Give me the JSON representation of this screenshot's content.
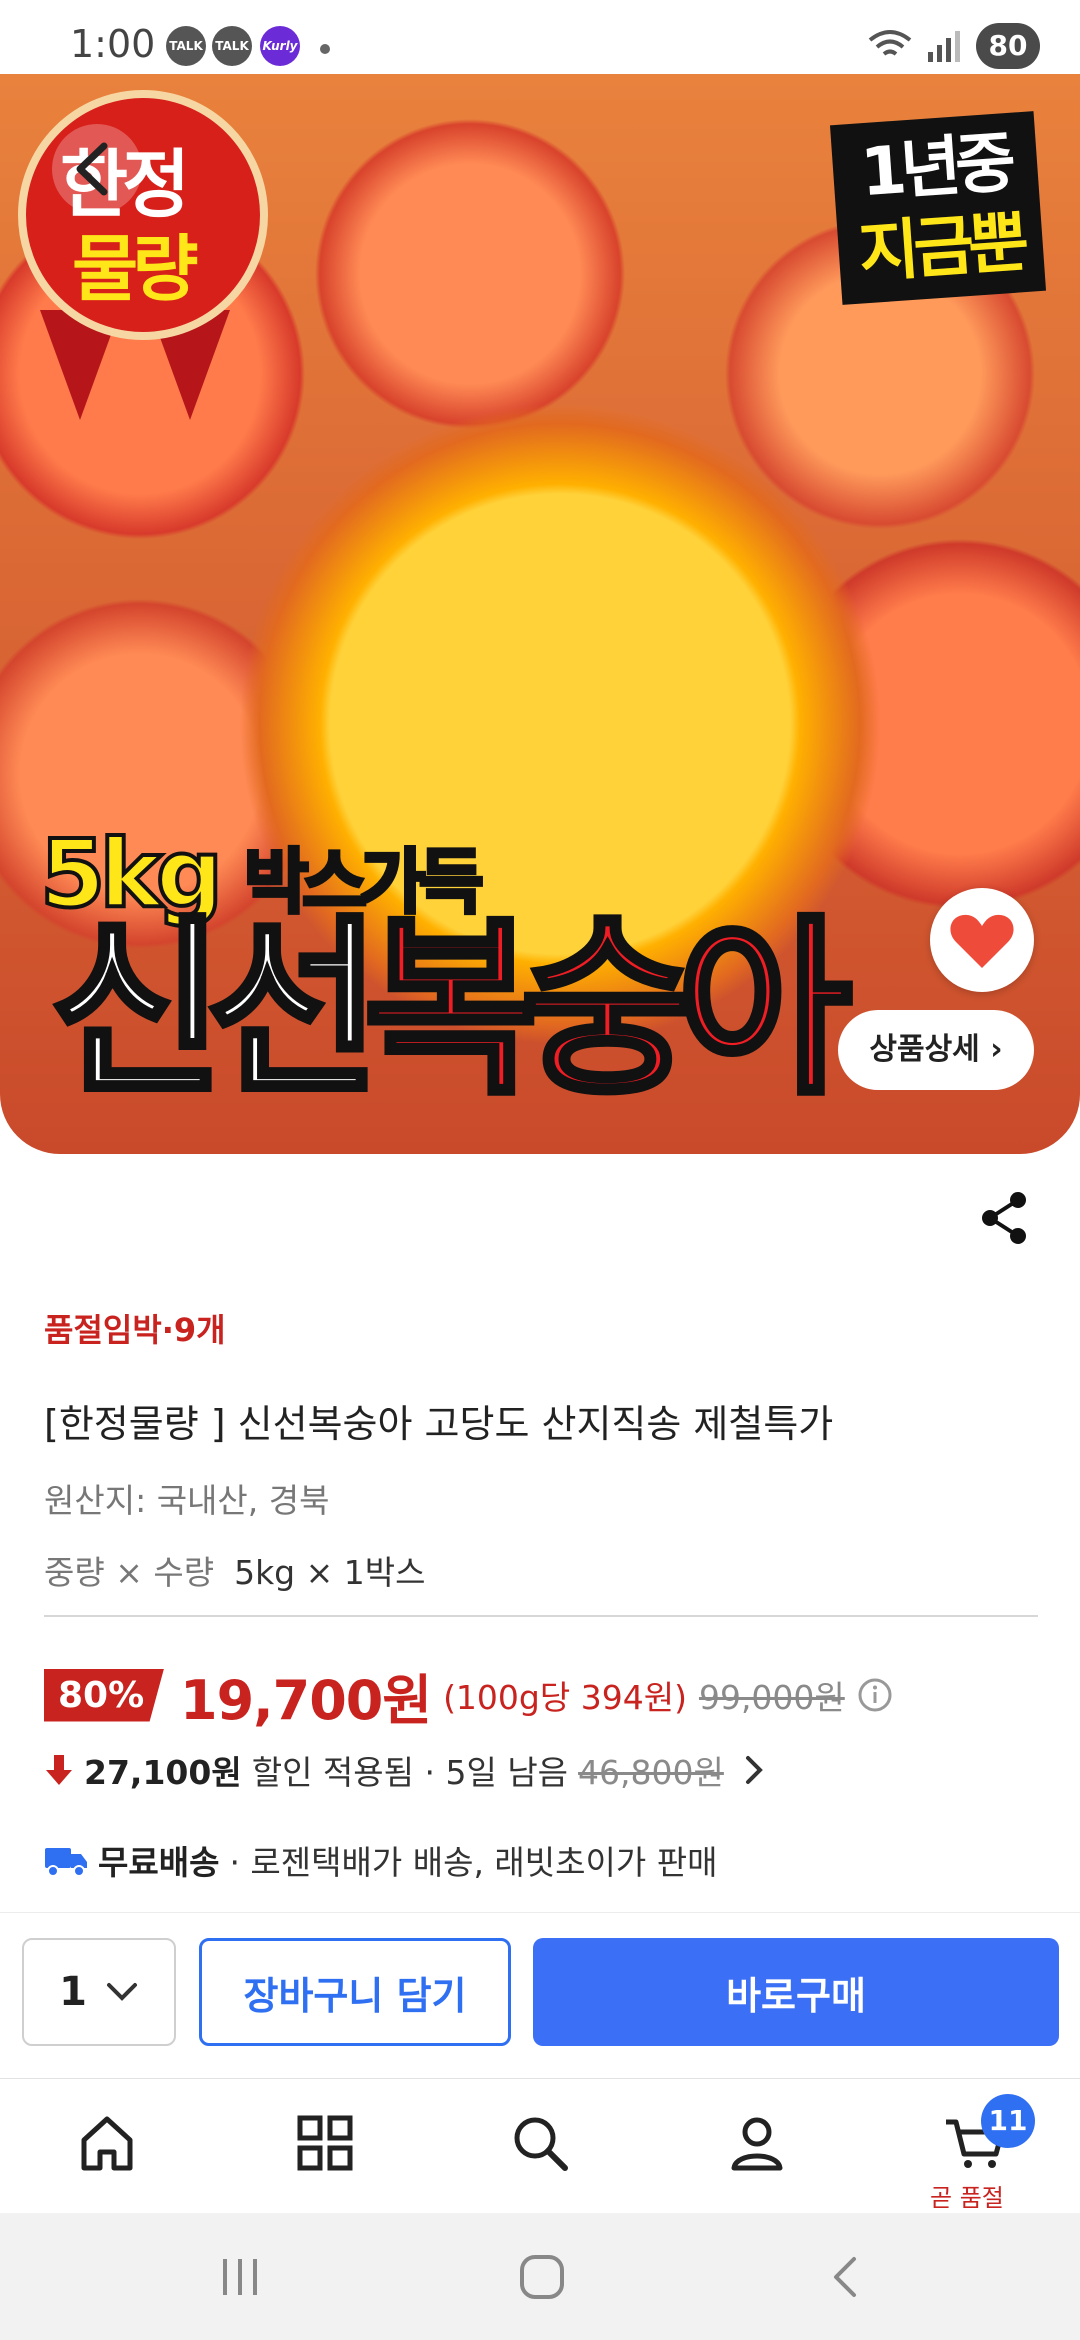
{
  "status_bar": {
    "time": "1:00",
    "talk1": "TALK",
    "talk2": "TALK",
    "kurly": "Kurly",
    "battery": "80"
  },
  "hero": {
    "seal_line1": "한정",
    "seal_line2": "물량",
    "badge_line1": "1년중",
    "badge_line2": "지금뿐",
    "line1_accent": "5kg",
    "line1_rest": "박스가득",
    "line2_white": "신선",
    "line2_red": "복숭아",
    "detail_button": "상품상세"
  },
  "product": {
    "stock_label": "품절임박·9개",
    "title": "[한정물량 ] 신선복숭아 고당도 산지직송 제철특가",
    "origin": "원산지: 국내산, 경북",
    "weight_label": "중량 × 수량",
    "weight_value": "5kg × 1박스"
  },
  "price": {
    "discount": "80%",
    "sale_price": "19,700원",
    "unit_price": "(100g당 394원)",
    "original_price": "99,000원"
  },
  "coupon": {
    "amount": "27,100원",
    "text": "할인 적용됨 · 5일 남음",
    "original": "46,800원"
  },
  "shipping": {
    "bold": "무료배송",
    "text": "· 로젠택배가 배송, 래빗초이가 판매"
  },
  "purchase": {
    "quantity": "1",
    "cart_label": "장바구니 담기",
    "buy_label": "바로구매"
  },
  "bottom_nav": {
    "cart_count": "11",
    "cart_status": "곧 품절"
  },
  "colors": {
    "accent_red": "#c8231f",
    "accent_blue": "#3b6ff5"
  }
}
